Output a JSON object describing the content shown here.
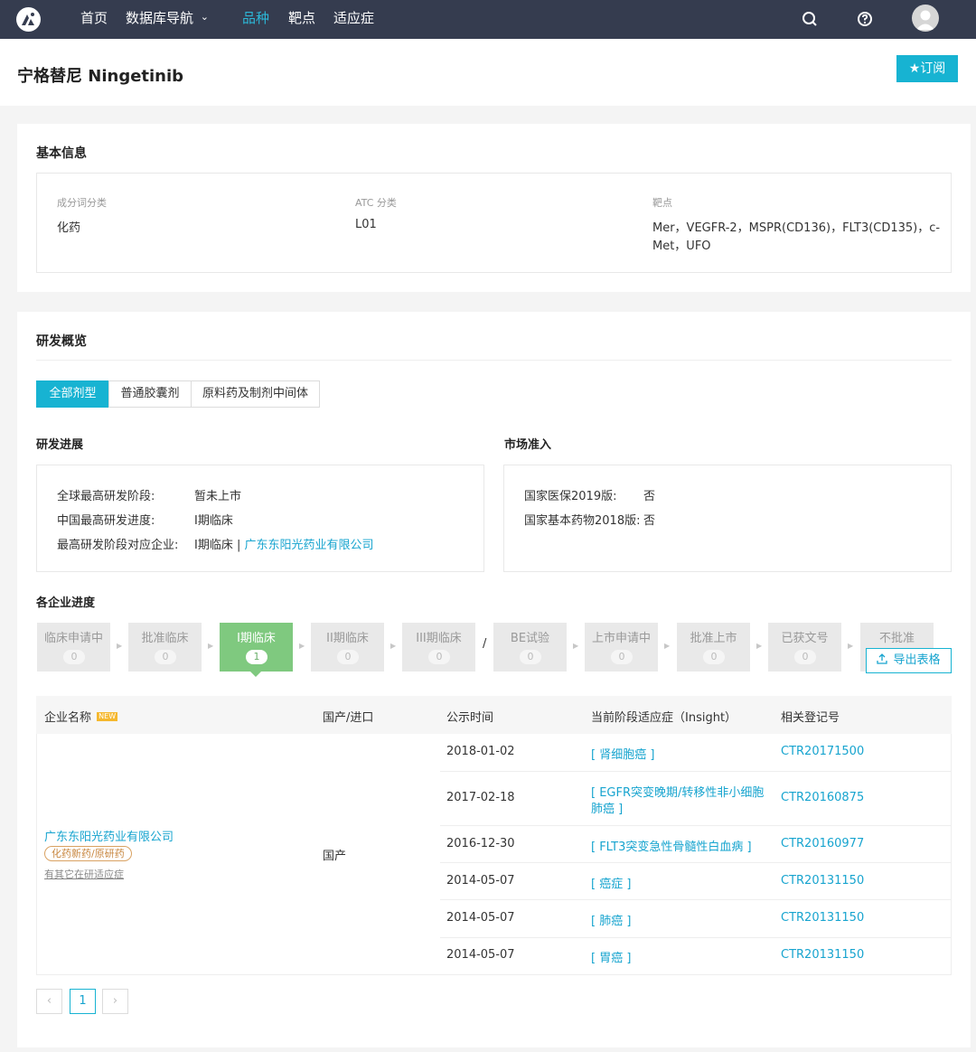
{
  "nav": {
    "items": [
      "首页",
      "数据库导航",
      "品种",
      "靶点",
      "适应症"
    ],
    "active_index": 2,
    "dropdown_marker": "⌄",
    "icons": [
      "search-icon",
      "help-icon",
      "user-avatar"
    ]
  },
  "title": {
    "name": "宁格替尼 Ningetinib",
    "subscribe_label": "★订阅"
  },
  "basic_info": {
    "title": "基本信息",
    "fields": [
      {
        "label": "成分词分类",
        "value": "化药"
      },
      {
        "label": "ATC 分类",
        "value": "L01"
      },
      {
        "label": "靶点",
        "value_line1": "Mer，VEGFR-2，MSPR(CD136)，FLT3(CD135)，c-",
        "value_line2": "Met，UFO"
      }
    ]
  },
  "overview": {
    "title": "研发概览",
    "tabs": [
      "全部剂型",
      "普通胶囊剂",
      "原料药及制剂中间体"
    ],
    "active_tab": 0,
    "progress": {
      "title": "研发进展",
      "rows": [
        {
          "label": "全球最高研发阶段:",
          "value": "暂未上市"
        },
        {
          "label": "中国最高研发进度:",
          "value": "I期临床"
        },
        {
          "label": "最高研发阶段对应企业:",
          "value": "I期临床 | ",
          "link": "广东东阳光药业有限公司"
        }
      ]
    },
    "market": {
      "title": "市场准入",
      "rows": [
        {
          "label": "国家医保2019版:",
          "value": "否"
        },
        {
          "label": "国家基本药物2018版:",
          "value": "否"
        }
      ]
    }
  },
  "company_progress": {
    "title": "各企业进度",
    "separator": "/",
    "stages": [
      {
        "label": "临床申请中",
        "count": "0"
      },
      {
        "label": "批准临床",
        "count": "0"
      },
      {
        "label": "I期临床",
        "count": "1"
      },
      {
        "label": "II期临床",
        "count": "0"
      },
      {
        "label": "III期临床",
        "count": "0"
      },
      {
        "label": "BE试验",
        "count": "0"
      },
      {
        "label": "上市申请中",
        "count": "0"
      },
      {
        "label": "批准上市",
        "count": "0"
      },
      {
        "label": "已获文号",
        "count": "0"
      },
      {
        "label": "不批准",
        "count": ""
      }
    ],
    "active_stage": 2,
    "export_label": "导出表格"
  },
  "table": {
    "headers": [
      "企业名称",
      "国产/进口",
      "公示时间",
      "当前阶段适应症（Insight）",
      "相关登记号"
    ],
    "new_badge": "NEW",
    "company": {
      "name": "广东东阳光药业有限公司",
      "tag": "化药新药/原研药",
      "note": "有其它在研适应症",
      "origin": "国产"
    },
    "rows": [
      {
        "date": "2018-01-02",
        "indication": "[ 肾细胞癌 ]",
        "reg": "CTR20171500"
      },
      {
        "date": "2017-02-18",
        "indication_line1": "[ EGFR突变晚期/转移性非小细胞",
        "indication_line2": "肺癌 ]",
        "reg": "CTR20160875"
      },
      {
        "date": "2016-12-30",
        "indication": "[ FLT3突变急性骨髓性白血病 ]",
        "reg": "CTR20160977"
      },
      {
        "date": "2014-05-07",
        "indication": "[ 癌症 ]",
        "reg": "CTR20131150"
      },
      {
        "date": "2014-05-07",
        "indication": "[ 肺癌 ]",
        "reg": "CTR20131150"
      },
      {
        "date": "2014-05-07",
        "indication": "[ 胃癌 ]",
        "reg": "CTR20131150"
      }
    ]
  },
  "pagination": {
    "prev": "‹",
    "current": "1",
    "next": "›"
  },
  "colors": {
    "nav_bg": "#353c4f",
    "accent": "#17b3d2",
    "active_stage": "#7fc97f",
    "link": "#17a4cf"
  }
}
